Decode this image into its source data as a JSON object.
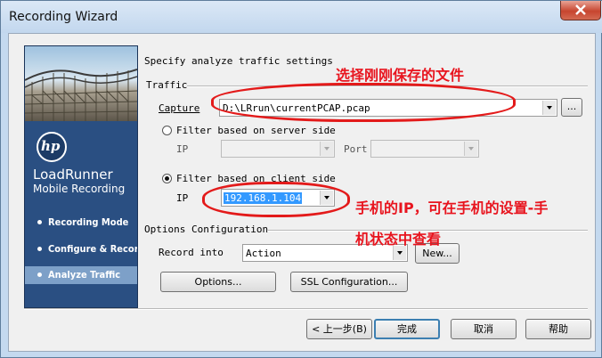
{
  "window": {
    "title": "Recording Wizard"
  },
  "sidebar": {
    "logo_text": "hp",
    "brand": "LoadRunner",
    "brand_sub": "Mobile Recording",
    "steps": [
      {
        "label": "Recording Mode",
        "active": false
      },
      {
        "label": "Configure & Record",
        "active": false
      },
      {
        "label": "Analyze Traffic",
        "active": true
      }
    ]
  },
  "content": {
    "heading": "Specify analyze traffic settings",
    "traffic_group": "Traffic",
    "capture_label": "Capture",
    "capture_value": "D:\\LRrun\\currentPCAP.pcap",
    "browse_label": "...",
    "server_radio_label": "Filter based on server side",
    "server_ip_label": "IP",
    "server_ip_value": "",
    "port_label": "Port",
    "port_value": "",
    "client_radio_label": "Filter based on client side",
    "client_ip_label": "IP",
    "client_ip_value": "192.168.1.104",
    "options_group": "Options Configuration",
    "record_into_label": "Record into",
    "record_into_value": "Action",
    "new_button": "New...",
    "options_button": "Options...",
    "ssl_button": "SSL Configuration..."
  },
  "footer": {
    "back_button": "< 上一步(B)",
    "finish_button": "完成",
    "cancel_button": "取消",
    "help_button": "帮助"
  },
  "annotations": {
    "capture_note": "选择刚刚保存的文件",
    "ip_note_line1": "手机的IP，可在手机的设置-手",
    "ip_note_line2": "机状态中查看"
  },
  "colors": {
    "sidebar_bg": "#2a4f82",
    "annotation_red": "#e31a1a",
    "selection": "#3399ff"
  }
}
